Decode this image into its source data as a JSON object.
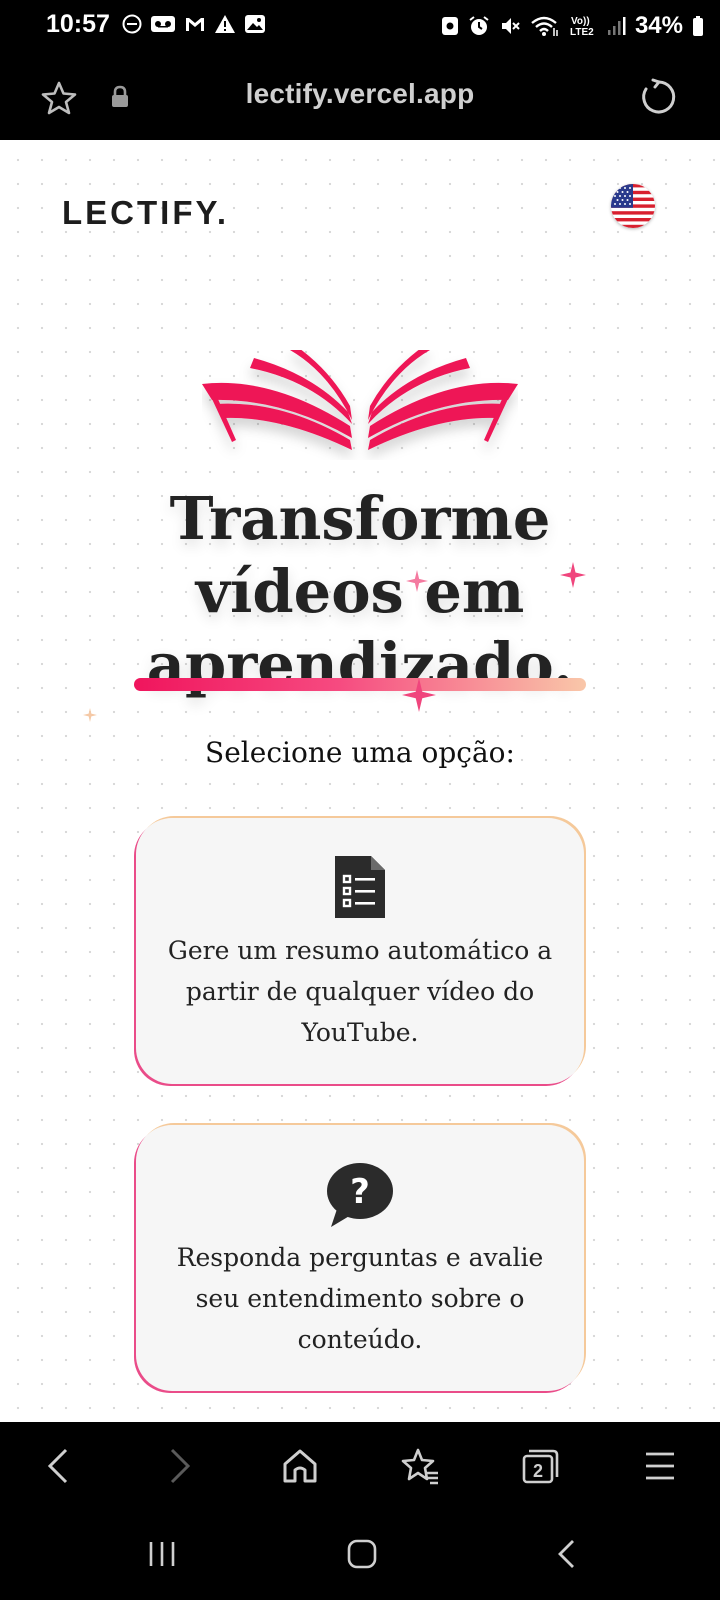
{
  "status_bar": {
    "time": "10:57",
    "battery": "34%",
    "left_icons": [
      "do-not-disturb-icon",
      "voicemail-icon",
      "gmail-icon",
      "warning-icon",
      "gallery-icon"
    ],
    "right_icons": [
      "vpn-icon",
      "alarm-icon",
      "mute-icon",
      "wifi-icon",
      "volte-icon",
      "signal-icon",
      "battery-icon"
    ],
    "network_label": "Vo))\nLTE2"
  },
  "browser": {
    "url": "lectify.vercel.app"
  },
  "header": {
    "logo": "LECTIFY.",
    "language_flag": "us-flag-icon"
  },
  "hero": {
    "line1": "Transforme",
    "line2": "vídeos em",
    "line3": "aprendizado.",
    "prompt": "Selecione uma opção:",
    "accent_color": "#f0155d"
  },
  "options": [
    {
      "icon": "document-list-icon",
      "text": "Gere um resumo automático a partir de qualquer vídeo do YouTube."
    },
    {
      "icon": "question-bubble-icon",
      "text": "Responda perguntas e avalie seu entendimento sobre o conteúdo."
    }
  ],
  "browser_nav": {
    "tab_count": "2"
  }
}
